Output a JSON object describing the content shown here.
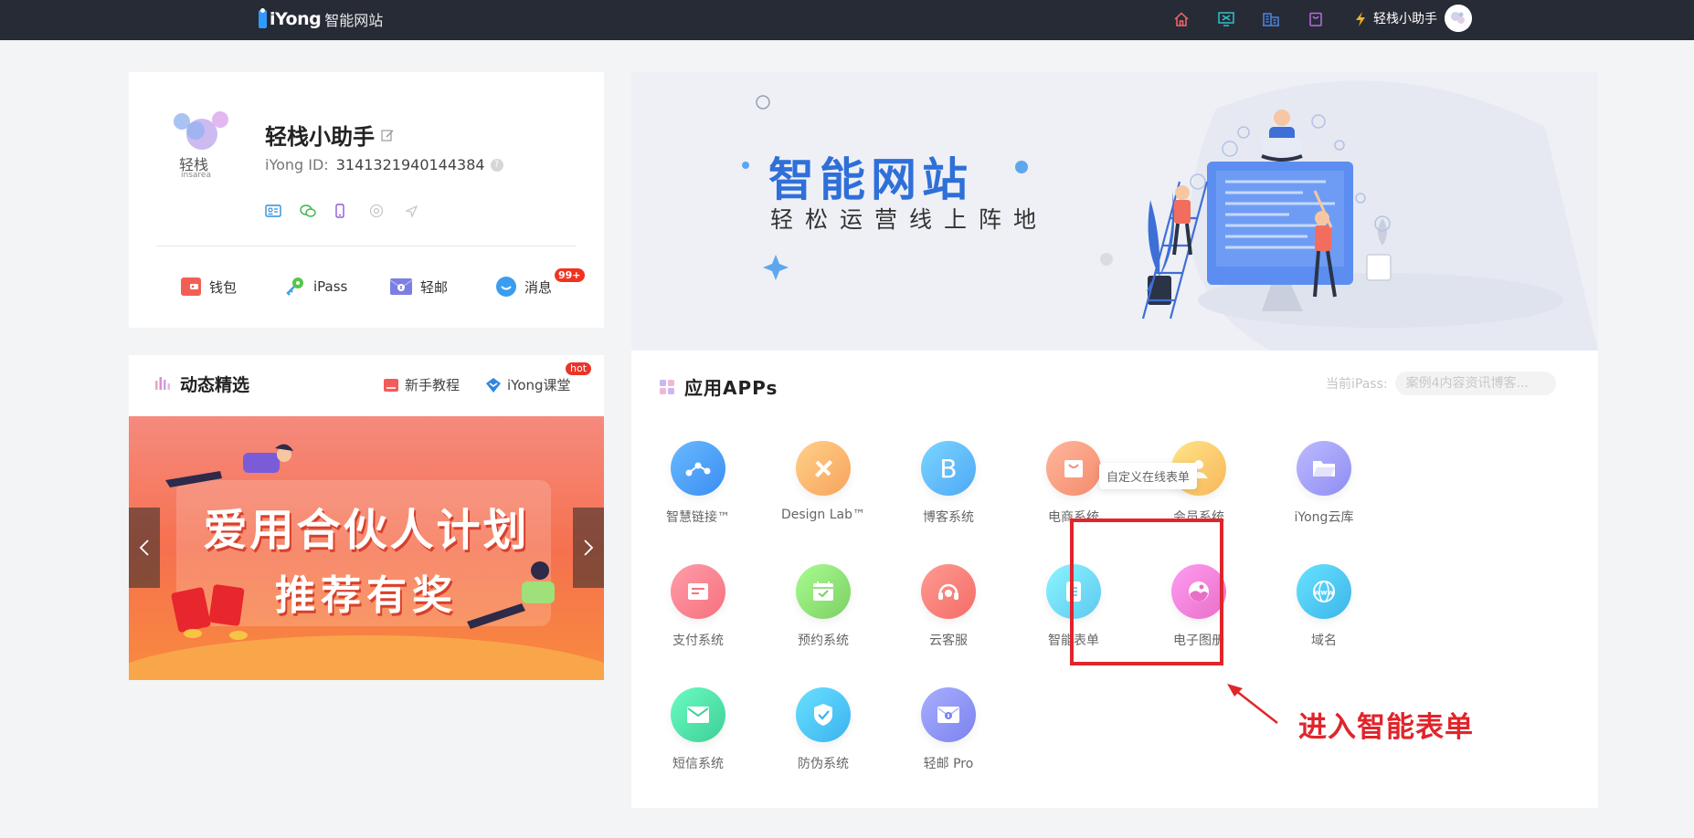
{
  "topbar": {
    "logo_brand": "iYong",
    "logo_sub": "智能网站",
    "nav_icons": [
      "home-icon",
      "monitor-icon",
      "building-icon",
      "bag-icon",
      "lightning-icon"
    ],
    "user_name": "轻栈小助手"
  },
  "profile": {
    "logo_text": "轻栈",
    "logo_sub": "insarea",
    "name": "轻栈小助手",
    "id_label": "iYong ID:",
    "id_value": "3141321940144384",
    "quick": {
      "wallet": "钱包",
      "ipass": "iPass",
      "mail": "轻邮",
      "message": "消息",
      "message_badge": "99+"
    }
  },
  "dynamic": {
    "title": "动态精选",
    "link_tutorial": "新手教程",
    "link_class": "iYong课堂",
    "hot_badge": "hot",
    "banner_line1": "爱用合伙人计划",
    "banner_line2": "推荐有奖"
  },
  "main": {
    "hero_title": "智能网站",
    "hero_subtitle": "轻松运营线上阵地",
    "apps_title": "应用APPs",
    "current_ipass_label": "当前iPass:",
    "current_ipass_value": "案例4内容资讯博客...",
    "tooltip": "自定义在线表单",
    "annotation": "进入智能表单",
    "apps": [
      {
        "name": "智慧链接™",
        "icon": "link-nodes-icon",
        "color": "#3b8df2"
      },
      {
        "name": "Design Lab™",
        "icon": "pencil-ruler-icon",
        "color": "#f7a35c"
      },
      {
        "name": "博客系统",
        "icon": "blog-b-icon",
        "color": "#4ea8f5"
      },
      {
        "name": "电商系统",
        "icon": "shopping-bag-icon",
        "color": "#f48a6e"
      },
      {
        "name": "会员系统",
        "icon": "member-icon",
        "color": "#f7b75a"
      },
      {
        "name": "iYong云库",
        "icon": "folder-icon",
        "color": "#8f8df2"
      },
      {
        "name": "支付系统",
        "icon": "wallet-icon",
        "color": "#f6707d"
      },
      {
        "name": "预约系统",
        "icon": "calendar-icon",
        "color": "#7bcf63"
      },
      {
        "name": "云客服",
        "icon": "headset-icon",
        "color": "#f36d66"
      },
      {
        "name": "智能表单",
        "icon": "form-icon",
        "color": "#5ec8f0"
      },
      {
        "name": "电子图册",
        "icon": "album-icon",
        "color": "#e86fc6"
      },
      {
        "name": "域名",
        "icon": "globe-icon",
        "color": "#3bb5e8"
      },
      {
        "name": "短信系统",
        "icon": "envelope-icon",
        "color": "#3dcf95"
      },
      {
        "name": "防伪系统",
        "icon": "shield-check-icon",
        "color": "#3bb3f0"
      },
      {
        "name": "轻邮 Pro",
        "icon": "mail-pro-icon",
        "color": "#7b82ee"
      }
    ]
  }
}
